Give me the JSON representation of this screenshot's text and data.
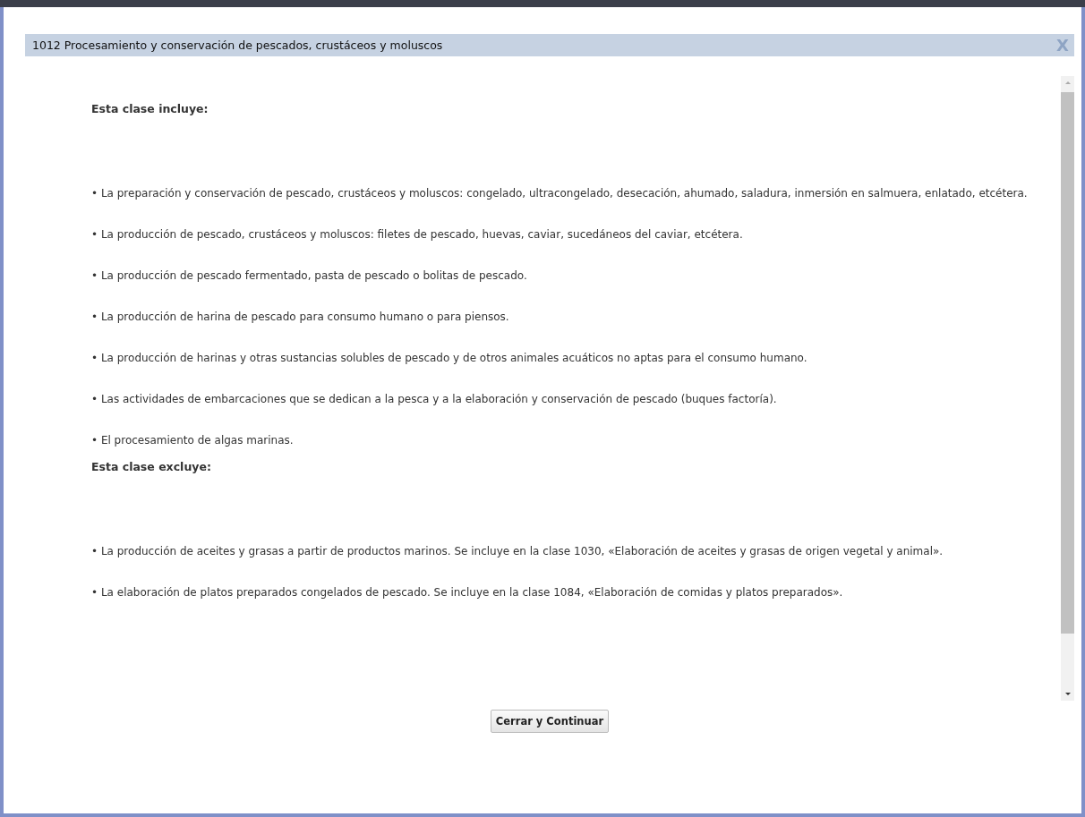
{
  "dialog": {
    "title": "1012 Procesamiento y conservación de pescados, crustáceos y moluscos",
    "close": "X",
    "sections": [
      {
        "heading": "Esta clase incluye:",
        "items": [
          "• La preparación y conservación de pescado, crustáceos y moluscos: congelado, ultracongelado, desecación, ahumado, saladura, inmersión en salmuera, enlatado, etcétera.",
          "• La producción de pescado, crustáceos y moluscos: filetes de pescado, huevas, caviar, sucedáneos del caviar, etcétera.",
          "• La producción de pescado fermentado, pasta de pescado o bolitas de pescado.",
          "• La producción de harina de pescado para consumo humano o para piensos.",
          "• La producción de harinas y otras sustancias solubles de pescado y de otros animales acuáticos no aptas para el consumo humano.",
          "• Las actividades de embarcaciones que se dedican a la pesca y a la elaboración y conservación de pescado (buques factoría).",
          "• El procesamiento de algas marinas."
        ]
      },
      {
        "heading": "Esta clase excluye:",
        "items": [
          "• La producción de aceites y grasas a partir de productos marinos. Se incluye en la clase 1030, «Elaboración de aceites y grasas de origen vegetal y animal».",
          "• La elaboración de platos preparados congelados de pescado. Se incluye en la clase 1084, «Elaboración de comidas y platos preparados»."
        ]
      }
    ],
    "button": "Cerrar y Continuar"
  }
}
